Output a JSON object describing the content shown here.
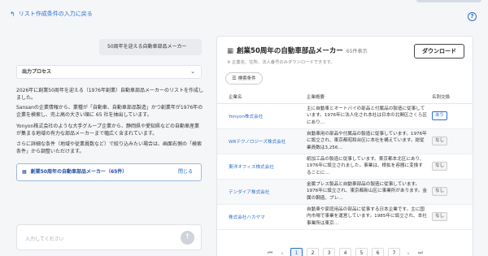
{
  "top": {
    "back_label": "リスト作成条件の入力に戻る",
    "back_icon": "arrow-left-icon",
    "help_icon": "help-circle-icon"
  },
  "chat": {
    "query": "50周年を迎える自動車部品メーカー",
    "process_label": "出力プロセス",
    "p1": "2026年に創業50周年を迎える（1976年創業）自動車部品メーカーのリストを作成しました。",
    "p2": "Sansanの企業情報から、業種が「自動車、自動車部品製造」かつ創業年が1976年の企業を検索し、売上高の大きい順に 65 社を抽出しています。",
    "p3": "Yonyon株式会社のような大手グループ企業から、静岡県や愛知県などの自動車産業が集まる地域の有力な部品メーカーまで幅広く含まれています。",
    "p4": "さらに詳細な条件（地域や従業員数など）で絞り込みたい場合は、画面右側の「検索条件」から調整いただけます。",
    "result_label": "創業50周年の自動車部品メーカー（65件）",
    "result_close": "閉じる",
    "input_placeholder": "入力してください"
  },
  "panel": {
    "title": "創業50周年の自動車部品メーカー",
    "count": "65件表示",
    "download": "ダウンロード",
    "note": "※ 企業名、住所、法人番号のみダウンロードできます。",
    "filter": "検索条件",
    "col_name": "企業名",
    "col_desc": "企業概要",
    "col_flag": "名刺交換",
    "rows": [
      {
        "name": "Yonyon株式会社",
        "desc": "主に自動車とオートバイの部品と付属品の製造に従事しています。1976年に法人化され本社は日本の北関区さくら区にあり…",
        "flag": "あり"
      },
      {
        "name": "WRテクノロジーズ株式会社",
        "desc": "自動車用の部品や付属品の製造に従事しています。1976年に設立され、東京都昭和台区に本社を構えています。総従業員数は3,256…",
        "flag": "なし"
      },
      {
        "name": "東洋オフィス株式会社",
        "desc": "紙加工品の製造に従事しています。東京都本北区にあり、1976年に設立されました。事業は、根拡を容器に変換することに…",
        "flag": "なし"
      },
      {
        "name": "テンダイア株式会社",
        "desc": "金属プレス製品と自動車部品の製造に従事しています。1976年に設立され、東京都新山区に事業所があります。金属の鋼造、プレ…",
        "flag": "なし"
      },
      {
        "name": "株式会社ハカヤマ",
        "desc": "自動車や家庭用品の部品に従事する日本企業です。主に国内市場で事業を運営しています。1985年に設立され、本社事業所は東京…",
        "flag": "なし"
      }
    ],
    "pages": [
      "1",
      "2",
      "3",
      "4",
      "5",
      "6",
      "7"
    ],
    "current_page": "1"
  }
}
